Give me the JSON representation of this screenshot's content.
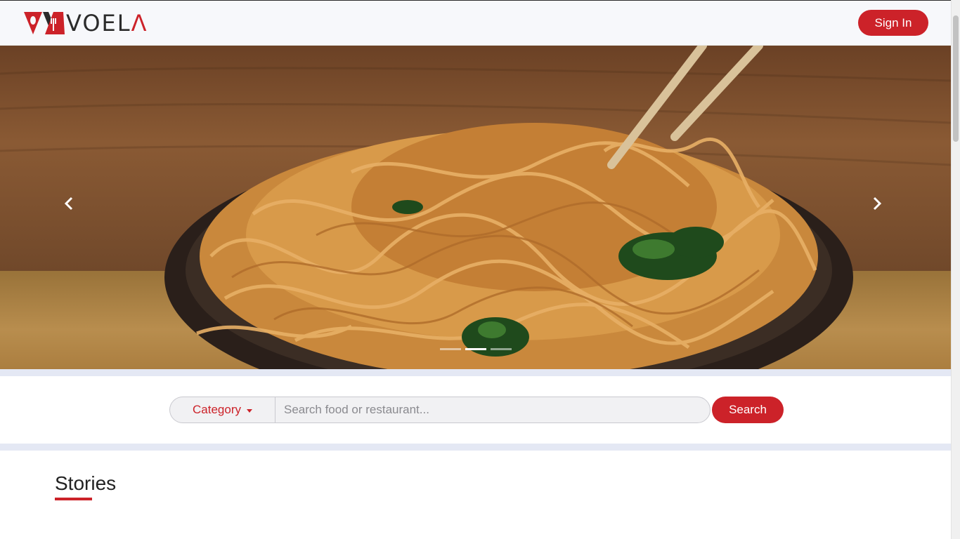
{
  "header": {
    "brand_prefix": "V",
    "brand_middle": "OEL",
    "brand_suffix": "Λ",
    "signin_label": "Sign In"
  },
  "hero": {
    "slide_count": 3,
    "active_slide": 2,
    "prev_icon": "chevron-left-icon",
    "next_icon": "chevron-right-icon"
  },
  "search": {
    "category_label": "Category",
    "placeholder": "Search food or restaurant...",
    "value": "",
    "button_label": "Search"
  },
  "stories": {
    "title": "Stories"
  },
  "colors": {
    "accent": "#cc2229",
    "band": "#e4e8f4",
    "header_bg": "#f7f8fb"
  }
}
